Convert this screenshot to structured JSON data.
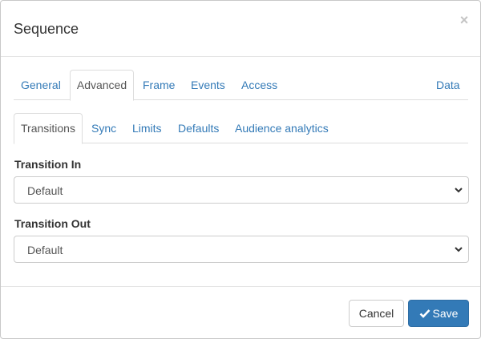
{
  "dialog": {
    "title": "Sequence",
    "close_glyph": "×"
  },
  "main_tabs": [
    {
      "label": "General",
      "active": false
    },
    {
      "label": "Advanced",
      "active": true
    },
    {
      "label": "Frame",
      "active": false
    },
    {
      "label": "Events",
      "active": false
    },
    {
      "label": "Access",
      "active": false
    },
    {
      "label": "Data",
      "active": false
    }
  ],
  "sub_tabs": [
    {
      "label": "Transitions",
      "active": true
    },
    {
      "label": "Sync",
      "active": false
    },
    {
      "label": "Limits",
      "active": false
    },
    {
      "label": "Defaults",
      "active": false
    },
    {
      "label": "Audience analytics",
      "active": false
    }
  ],
  "form": {
    "transition_in": {
      "label": "Transition In",
      "value": "Default"
    },
    "transition_out": {
      "label": "Transition Out",
      "value": "Default"
    }
  },
  "footer": {
    "cancel_label": "Cancel",
    "save_label": "Save"
  },
  "icons": {
    "close": "close-icon",
    "chevron": "chevron-down-icon",
    "check": "check-icon"
  },
  "colors": {
    "link": "#337ab7",
    "primary": "#337ab7",
    "border": "#dddddd"
  }
}
